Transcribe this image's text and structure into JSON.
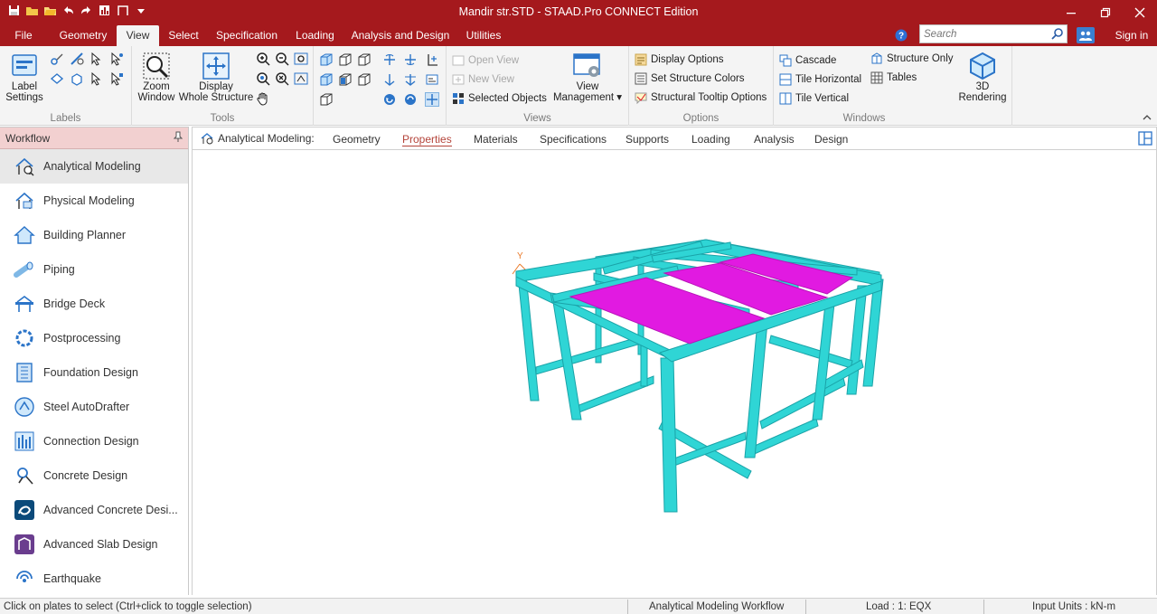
{
  "window": {
    "title": "Mandir str.STD - STAAD.Pro CONNECT Edition"
  },
  "menu": {
    "tabs": [
      {
        "label": "File"
      },
      {
        "label": "Geometry"
      },
      {
        "label": "View"
      },
      {
        "label": "Select"
      },
      {
        "label": "Specification"
      },
      {
        "label": "Loading"
      },
      {
        "label": "Analysis and Design"
      },
      {
        "label": "Utilities"
      }
    ],
    "active_tab": "View",
    "search_placeholder": "Search",
    "sign_in": "Sign in"
  },
  "ribbon": {
    "labels_group": {
      "button": "Label\nSettings",
      "title": "Labels"
    },
    "tools_group": {
      "zoom": "Zoom\nWindow",
      "display": "Display\nWhole Structure",
      "title": "Tools"
    },
    "views_group": {
      "open_view": "Open View",
      "new_view": "New View",
      "selected_objects": "Selected Objects",
      "view_management": "View\nManagement ▾",
      "title": "Views"
    },
    "options_group": {
      "display_options": "Display Options",
      "set_structure_colors": "Set Structure Colors",
      "structural_tooltip": "Structural Tooltip Options",
      "title": "Options"
    },
    "windows_group": {
      "cascade": "Cascade",
      "tile_horizontal": "Tile Horizontal",
      "tile_vertical": "Tile Vertical",
      "structure_only": "Structure Only",
      "tables": "Tables",
      "title": "Windows"
    },
    "rendering": {
      "button": "3D\nRendering"
    }
  },
  "workflow": {
    "title": "Workflow",
    "items": [
      {
        "label": "Analytical Modeling",
        "icon": "analytical-icon"
      },
      {
        "label": "Physical Modeling",
        "icon": "physical-icon"
      },
      {
        "label": "Building Planner",
        "icon": "house-icon"
      },
      {
        "label": "Piping",
        "icon": "pipe-icon"
      },
      {
        "label": "Bridge Deck",
        "icon": "bridge-icon"
      },
      {
        "label": "Postprocessing",
        "icon": "ring-icon"
      },
      {
        "label": "Foundation Design",
        "icon": "foundation-icon"
      },
      {
        "label": "Steel AutoDrafter",
        "icon": "drafter-icon"
      },
      {
        "label": "Connection Design",
        "icon": "connection-icon"
      },
      {
        "label": "Concrete Design",
        "icon": "concrete-icon"
      },
      {
        "label": "Advanced Concrete Desi...",
        "icon": "adv-concrete-icon"
      },
      {
        "label": "Advanced Slab Design",
        "icon": "slab-icon"
      },
      {
        "label": "Earthquake",
        "icon": "earthquake-icon"
      }
    ]
  },
  "viewheader": {
    "title": "Analytical Modeling:",
    "tabs": [
      "Geometry",
      "Properties",
      "Materials",
      "Specifications",
      "Supports",
      "Loading",
      "Analysis",
      "Design"
    ],
    "active": "Properties"
  },
  "viewport": {
    "axis_label": "Y",
    "member_color": "#2fd5d5",
    "plate_color": "#e11ae1"
  },
  "status": {
    "message": "Click on plates to select (Ctrl+click to toggle selection)",
    "workflow": "Analytical Modeling Workflow",
    "load": "Load : 1: EQX",
    "units": "Input Units : kN-m"
  },
  "colors": {
    "brand": "#a5191d",
    "panel_header": "#f2d0d0",
    "active_tab_text": "#b4443a"
  }
}
